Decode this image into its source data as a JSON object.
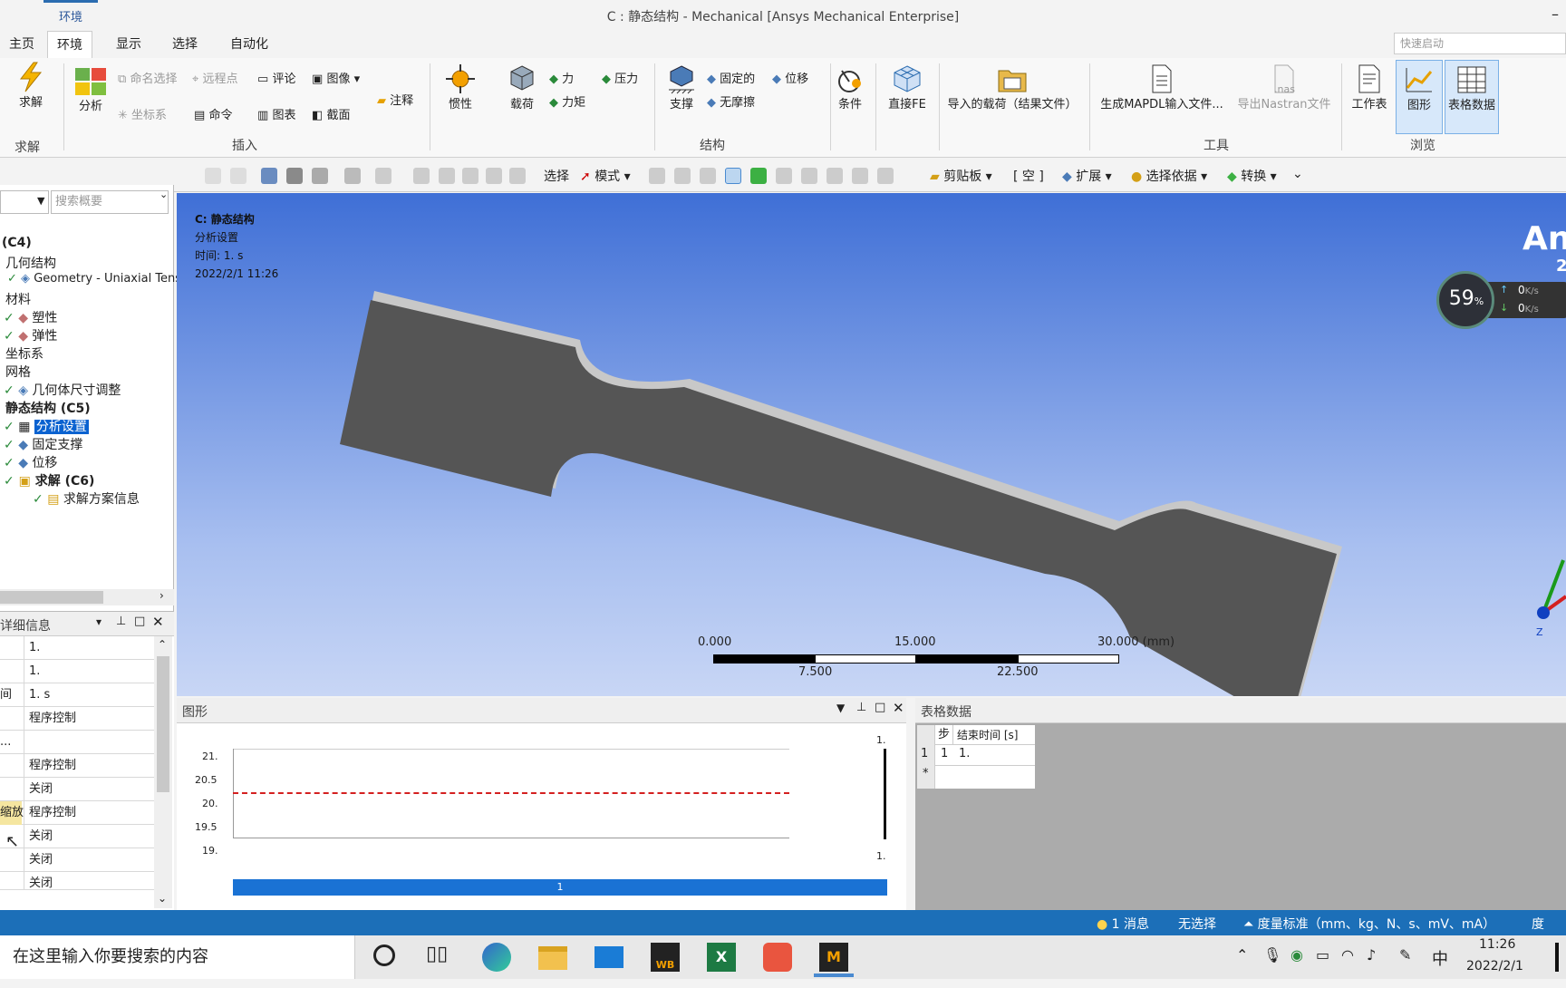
{
  "window": {
    "context_tab": "环境",
    "title": "C : 静态结构 - Mechanical [Ansys Mechanical Enterprise]",
    "quick_launch": "快速启动"
  },
  "tabs": [
    "主页",
    "环境",
    "显示",
    "选择",
    "自动化"
  ],
  "ribbon": {
    "solve": "求解",
    "solve_group": "求解",
    "analysis": "分析",
    "named_sel": "命名选择",
    "remote_pt": "远程点",
    "comment": "评论",
    "image": "图像",
    "coord": "坐标系",
    "command": "命令",
    "chart": "图表",
    "section": "截面",
    "annotation": "注释",
    "insert_group": "插入",
    "inertia": "惯性",
    "load": "载荷",
    "force": "力",
    "pressure": "压力",
    "moment": "力矩",
    "support": "支撑",
    "fixed": "固定的",
    "displacement": "位移",
    "frictionless": "无摩擦",
    "struct_group": "结构",
    "condition": "条件",
    "direct_fe": "直接FE",
    "import_load": "导入的载荷（结果文件）",
    "mapdl": "生成MAPDL输入文件...",
    "nastran": "导出Nastran文件",
    "nas": ".nas",
    "tools_group": "工具",
    "worksheet": "工作表",
    "graph": "图形",
    "tabular": "表格数据",
    "browse_group": "浏览"
  },
  "toolbar": {
    "select": "选择",
    "mode": "模式",
    "clipboard": "剪贴板",
    "empty": "[ 空 ]",
    "extend": "扩展",
    "select_by": "选择依据",
    "convert": "转换"
  },
  "outline": {
    "search": "搜索概要",
    "items": [
      "(C4)",
      "几何结构",
      "Geometry - Uniaxial Tens",
      "材料",
      "塑性",
      "弹性",
      "坐标系",
      "网格",
      "几何体尺寸调整",
      "静态结构 (C5)",
      "分析设置",
      "固定支撑",
      "位移",
      "求解 (C6)",
      "求解方案信息"
    ]
  },
  "details": {
    "title": "详细信息",
    "rows": [
      "1.",
      "1.",
      "1. s",
      "程序控制",
      "...",
      "程序控制",
      "关闭",
      "程序控制",
      "关闭",
      "关闭",
      "关闭"
    ],
    "label_time": "间",
    "label_cut": "缩放"
  },
  "viewport": {
    "line1": "C: 静态结构",
    "line2": "分析设置",
    "line3": "时间: 1. s",
    "line4": "2022/2/1 11:26",
    "scale_top": [
      "0.000",
      "15.000",
      "30.000 (mm)"
    ],
    "scale_bottom": [
      "7.500",
      "22.500"
    ],
    "brand": "An",
    "brand2": "2",
    "net_pct": "59",
    "pct_sign": "%",
    "net_up": "0",
    "net_down": "0",
    "net_unit": "K/s",
    "axis_z": "Z"
  },
  "graph": {
    "title": "图形",
    "ticks": [
      "21.",
      "20.5",
      "20.",
      "19.5",
      "19."
    ],
    "top_label": "1.",
    "bottom_label": "1.",
    "timeline": "1"
  },
  "table": {
    "title": "表格数据",
    "col_step": "步",
    "col_end": "结束时间 [s]",
    "row_idx": "1",
    "row_step": "1",
    "row_end": "1.",
    "new_row": "*"
  },
  "status": {
    "messages": "1 消息",
    "no_sel": "无选择",
    "units": "度量标准（mm、kg、N、s、mV、mA）",
    "deg": "度"
  },
  "taskbar": {
    "search": "在这里输入你要搜索的内容",
    "time": "11:26",
    "date": "2022/2/1",
    "ime": "中",
    "wb": "WB",
    "excel": "X",
    "mech": "M"
  },
  "colors": {
    "accent": "#2b73c8",
    "status_bar": "#1c6fb8",
    "selection": "#0a62d0",
    "limit_line": "#d42020"
  }
}
